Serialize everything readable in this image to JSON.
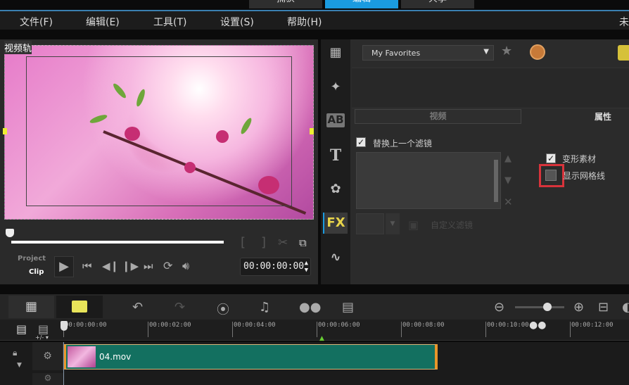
{
  "top_tabs": [
    {
      "label": "捕获"
    },
    {
      "label": "编辑",
      "active": true
    },
    {
      "label": "共享"
    }
  ],
  "menu": {
    "items": [
      "文件(F)",
      "编辑(E)",
      "工具(T)",
      "设置(S)",
      "帮助(H)"
    ],
    "right_cut": "未"
  },
  "preview": {
    "track_label": "视频轨",
    "project_label": "Project",
    "clip_label": "Clip",
    "timecode": "00:00:00:00",
    "mark_in": "[",
    "mark_out": "]"
  },
  "library": {
    "dropdown": "My Favorites",
    "tab_video": "视频",
    "tab_attributes": "属性",
    "replace_filter": "替换上一个滤镜",
    "replace_filter_checked": true,
    "custom_filter": "自定义滤镜",
    "distort_clip": "变形素材",
    "distort_clip_checked": true,
    "show_grid": "显示网格线",
    "show_grid_checked": false,
    "fx_label": "FX",
    "ab_label": "AB",
    "title_label": "T"
  },
  "timeline": {
    "ticks": [
      "00:00:00:00",
      "00:00:02:00",
      "00:00:04:00",
      "00:00:06:00",
      "00:00:08:00",
      "00:00:10:00",
      "00:00:12:00"
    ],
    "add_remove": "+/- ▾",
    "clip_name": "04.mov",
    "zoom_level": 0.75
  },
  "colors": {
    "accent": "#1a9be0",
    "clip": "#137060",
    "highlight": "#d8333b"
  }
}
